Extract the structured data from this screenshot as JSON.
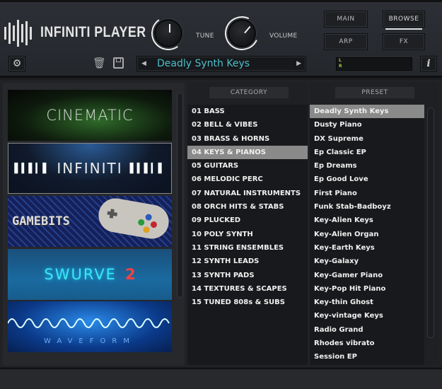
{
  "header": {
    "app_title": "INFINITI PLAYER",
    "knobs": [
      {
        "label": "TUNE",
        "value_fraction": 0.5
      },
      {
        "label": "VOLUME",
        "value_fraction": 0.8
      }
    ],
    "nav_buttons": [
      "MAIN",
      "BROWSE",
      "ARP",
      "FX"
    ],
    "active_nav": "BROWSE",
    "preset_name": "Deadly Synth Keys",
    "meter_labels": [
      "L",
      "R"
    ],
    "info_label": "i"
  },
  "libraries": [
    {
      "name": "CINEMATIC"
    },
    {
      "name": "INFINITI"
    },
    {
      "name": "GAMEBITS"
    },
    {
      "name": "SWURVE",
      "suffix": "2"
    },
    {
      "name": "WAVEFORM"
    }
  ],
  "category": {
    "header": "CATEGORY",
    "selected": 3,
    "items": [
      "01 BASS",
      "02 BELL & VIBES",
      "03 BRASS & HORNS",
      "04 KEYS & PIANOS",
      "05 GUITARS",
      "06 MELODIC PERC",
      "07 NATURAL INSTRUMENTS",
      "08 ORCH HITS & STABS",
      "09 PLUCKED",
      "10 POLY SYNTH",
      "11 STRING ENSEMBLES",
      "12 SYNTH LEADS",
      "13 SYNTH PADS",
      "14 TEXTURES & SCAPES",
      "15 TUNED 808s & SUBS"
    ]
  },
  "preset": {
    "header": "PRESET",
    "selected": 0,
    "items": [
      "Deadly Synth Keys",
      "Dusty Piano",
      "DX Supreme",
      "Ep Classic EP",
      "Ep Dreams",
      "Ep Good Love",
      "First Piano",
      "Funk Stab-Badboyz",
      "Key-Alien Keys",
      "Key-Alien Organ",
      "Key-Earth Keys",
      "Key-Galaxy",
      "Key-Gamer Piano",
      "Key-Pop Hit Piano",
      "Key-thin Ghost",
      "Key-vintage Keys",
      "Radio Grand",
      "Rhodes vibrato",
      "Session EP"
    ]
  },
  "colors": {
    "accent": "#4dbec9",
    "selection": "#8a8a8a"
  }
}
